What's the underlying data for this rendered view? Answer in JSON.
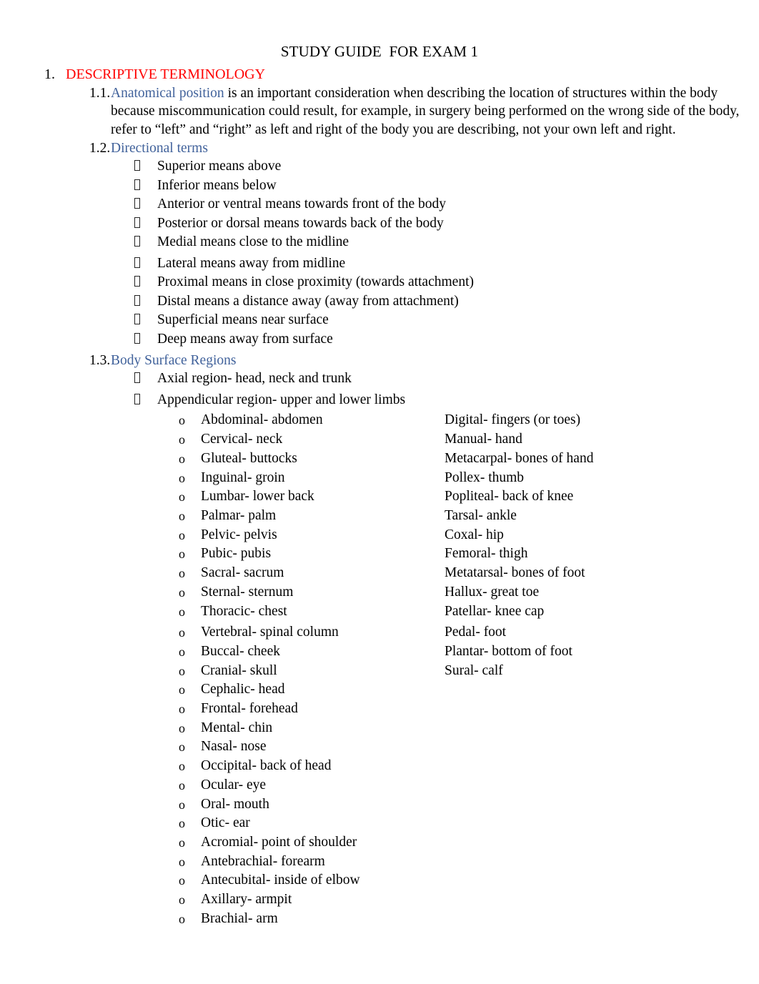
{
  "document": {
    "title": "STUDY GUIDE  FOR EXAM 1",
    "section_1": {
      "number": "1.",
      "heading": "DESCRIPTIVE TERMINOLOGY",
      "heading_color": "#FF0000",
      "subheading_color": "#41629B",
      "items": {
        "s1_1": {
          "number": "1.1.",
          "head": "Anatomical position",
          "body": " is an important consideration when describing the location of structures within the body because miscommunication could result, for example, in surgery being performed on the wrong side of the body, refer to “left” and “right” as left and right of the body you are describing, not your own left and right."
        },
        "s1_2": {
          "number": "1.2.",
          "head": "Directional terms",
          "bullets": [
            "Superior means above",
            "Inferior means below",
            "Anterior or ventral means towards front of the body",
            "Posterior or dorsal means towards back of the body",
            "Medial means close to the midline",
            "Lateral means away from midline",
            "Proximal means in close proximity (towards attachment)",
            "Distal means a distance away (away from attachment)",
            "Superficial means near surface",
            "Deep means away from surface"
          ]
        },
        "s1_3": {
          "number": "1.3.",
          "head": " Body Surface Regions",
          "bullets": [
            "Axial region- head, neck and trunk",
            "Appendicular region- upper and lower limbs"
          ],
          "regions_left": [
            "Abdominal- abdomen",
            "Cervical- neck",
            "Gluteal- buttocks",
            "Inguinal- groin",
            "Lumbar- lower back",
            "Palmar- palm",
            "Pelvic- pelvis",
            "Pubic- pubis",
            "Sacral- sacrum",
            "Sternal- sternum",
            "Thoracic- chest",
            "Vertebral- spinal column",
            "Buccal- cheek",
            "Cranial- skull",
            "Cephalic- head",
            "Frontal- forehead",
            "Mental- chin",
            "Nasal- nose",
            "Occipital- back of head",
            "Ocular- eye",
            "Oral- mouth",
            "Otic- ear",
            "Acromial- point of shoulder",
            "Antebrachial- forearm",
            "Antecubital- inside of elbow",
            "Axillary- armpit",
            "Brachial- arm"
          ],
          "regions_right": [
            "Digital- fingers (or toes)",
            "Manual- hand",
            "Metacarpal- bones of hand",
            "Pollex- thumb",
            "Popliteal- back of knee",
            "Tarsal- ankle",
            "Coxal- hip",
            "Femoral- thigh",
            "Metatarsal- bones of foot",
            "Hallux- great toe",
            "Patellar- knee cap",
            "Pedal- foot",
            "Plantar- bottom of foot",
            "Sural- calf"
          ],
          "bullet_marker": "o"
        }
      }
    }
  }
}
